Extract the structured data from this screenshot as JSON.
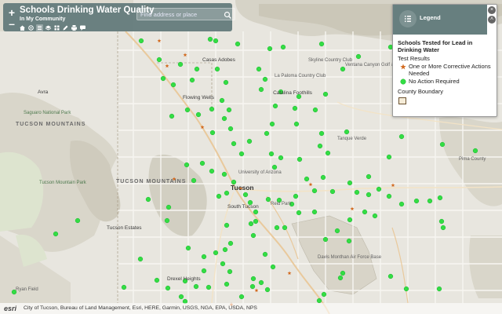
{
  "header": {
    "title": "Schools Drinking Water Quality",
    "subtitle": "In My Community",
    "search_placeholder": "Find address or place",
    "zoom_in": "+",
    "zoom_out": "–"
  },
  "legend": {
    "title": "Legend",
    "layer_title": "Schools Tested for Lead in Drinking Water",
    "test_results_label": "Test Results",
    "items": [
      {
        "label": "One or More Corrective Actions Needed",
        "symbol": "star",
        "color": "#d2691e"
      },
      {
        "label": "No Action Required",
        "symbol": "circle",
        "color": "#33dd44"
      }
    ],
    "boundary_label": "County Boundary"
  },
  "attribution": {
    "logo": "esri",
    "text": "City of Tucson, Bureau of Land Management, Esri, HERE, Garmin, USGS, NGA, EPA, USDA, NPS"
  },
  "colors": {
    "header_bg": "#5f7878",
    "no_action": "#33dd44",
    "corrective": "#d2691e",
    "land": "#e8e6df",
    "terrain": "#d9d7cc"
  },
  "icons": [
    "plus-icon",
    "minus-icon",
    "home-icon",
    "locate-icon",
    "list-icon",
    "layers-icon",
    "grid-icon",
    "pencil-icon",
    "print-icon",
    "chat-icon",
    "search-icon",
    "legend-list-icon",
    "chevron-up-icon",
    "close-icon"
  ],
  "map_labels": {
    "casas_adobes": "Casas Adobes",
    "flowing_wells": "Flowing Wells",
    "catalina_foothills": "Catalina Foothills",
    "tucson_mountains": "TUCSON MOUNTAINS",
    "tucson_mountains_2": "TUCSON MOUNTAINS",
    "tucson": "Tucson",
    "south_tucson": "South Tucson",
    "tucson_estates": "Tucson Estates",
    "drexel_heights": "Drexel Heights",
    "avra": "Avra",
    "saguaro_np": "Saguaro National Park",
    "tucson_mountain_park": "Tucson Mountain Park",
    "dm_afb": "Davis Monthan Air Force Base",
    "u_of_a": "University of Arizona",
    "la_paloma": "La Paloma Country Club",
    "skyline": "Skyline Country Club",
    "ventana": "Ventana Canyon Golf & Racquet Club",
    "tanque_verde": "Tanque Verde",
    "reid_park": "Reid Park",
    "ryan_field": "Ryan Field",
    "pima_county": "Pima County"
  },
  "chart_data": {
    "type": "scatter",
    "title": "Schools Tested for Lead in Drinking Water",
    "series": [
      {
        "name": "One or More Corrective Actions Needed",
        "symbol": "star",
        "points": [
          [
            203,
            52
          ],
          [
            236,
            70
          ],
          [
            213,
            84
          ],
          [
            258,
            162
          ],
          [
            222,
            228
          ],
          [
            369,
            348
          ],
          [
            396,
            235
          ],
          [
            501,
            236
          ],
          [
            449,
            266
          ],
          [
            327,
            370
          ],
          [
            295,
            388
          ],
          [
            187,
            8
          ],
          [
            307,
            240
          ]
        ]
      },
      {
        "name": "No Action Required",
        "symbol": "circle",
        "points": [
          [
            180,
            52
          ],
          [
            275,
            52
          ],
          [
            268,
            50
          ],
          [
            303,
            56
          ],
          [
            344,
            62
          ],
          [
            361,
            60
          ],
          [
            410,
            56
          ],
          [
            437,
            88
          ],
          [
            457,
            72
          ],
          [
            498,
            60
          ],
          [
            203,
            76
          ],
          [
            208,
            100
          ],
          [
            230,
            82
          ],
          [
            251,
            88
          ],
          [
            245,
            102
          ],
          [
            221,
            108
          ],
          [
            277,
            88
          ],
          [
            288,
            105
          ],
          [
            330,
            88
          ],
          [
            338,
            101
          ],
          [
            333,
            114
          ],
          [
            358,
            117
          ],
          [
            381,
            123
          ],
          [
            351,
            135
          ],
          [
            376,
            138
          ],
          [
            402,
            140
          ],
          [
            415,
            120
          ],
          [
            378,
            158
          ],
          [
            347,
            158
          ],
          [
            283,
            128
          ],
          [
            292,
            140
          ],
          [
            270,
            139
          ],
          [
            239,
            140
          ],
          [
            219,
            148
          ],
          [
            253,
            146
          ],
          [
            286,
            151
          ],
          [
            294,
            164
          ],
          [
            271,
            169
          ],
          [
            298,
            183
          ],
          [
            318,
            180
          ],
          [
            308,
            196
          ],
          [
            346,
            196
          ],
          [
            358,
            201
          ],
          [
            350,
            213
          ],
          [
            382,
            203
          ],
          [
            408,
            186
          ],
          [
            410,
            170
          ],
          [
            442,
            168
          ],
          [
            512,
            174
          ],
          [
            564,
            184
          ],
          [
            606,
            192
          ],
          [
            238,
            210
          ],
          [
            258,
            208
          ],
          [
            247,
            230
          ],
          [
            270,
            218
          ],
          [
            286,
            222
          ],
          [
            298,
            232
          ],
          [
            289,
            246
          ],
          [
            279,
            250
          ],
          [
            313,
            248
          ],
          [
            319,
            258
          ],
          [
            326,
            270
          ],
          [
            342,
            254
          ],
          [
            356,
            255
          ],
          [
            372,
            260
          ],
          [
            381,
            271
          ],
          [
            401,
            270
          ],
          [
            391,
            228
          ],
          [
            412,
            226
          ],
          [
            424,
            244
          ],
          [
            446,
            233
          ],
          [
            455,
            245
          ],
          [
            470,
            248
          ],
          [
            483,
            241
          ],
          [
            496,
            250
          ],
          [
            512,
            260
          ],
          [
            531,
            256
          ],
          [
            548,
            256
          ],
          [
            561,
            252
          ],
          [
            465,
            270
          ],
          [
            478,
            275
          ],
          [
            446,
            280
          ],
          [
            430,
            294
          ],
          [
            445,
            307
          ],
          [
            563,
            282
          ],
          [
            565,
            290
          ],
          [
            560,
            368
          ],
          [
            518,
            368
          ],
          [
            498,
            352
          ],
          [
            437,
            348
          ],
          [
            434,
            354
          ],
          [
            413,
            375
          ],
          [
            407,
            383
          ],
          [
            289,
            287
          ],
          [
            294,
            310
          ],
          [
            287,
            318
          ],
          [
            275,
            322
          ],
          [
            260,
            327
          ],
          [
            284,
            336
          ],
          [
            293,
            346
          ],
          [
            289,
            362
          ],
          [
            323,
            355
          ],
          [
            333,
            360
          ],
          [
            322,
            365
          ],
          [
            348,
            340
          ],
          [
            338,
            324
          ],
          [
            323,
            300
          ],
          [
            320,
            285
          ],
          [
            326,
            282
          ],
          [
            179,
            330
          ],
          [
            158,
            366
          ],
          [
            200,
            357
          ],
          [
            214,
            367
          ],
          [
            236,
            358
          ],
          [
            250,
            365
          ],
          [
            231,
            378
          ],
          [
            236,
            384
          ],
          [
            266,
            366
          ],
          [
            260,
            345
          ],
          [
            240,
            316
          ],
          [
            213,
            281
          ],
          [
            215,
            264
          ],
          [
            189,
            254
          ],
          [
            99,
            281
          ],
          [
            71,
            298
          ],
          [
            18,
            372
          ],
          [
            308,
            378
          ],
          [
            341,
            369
          ],
          [
            353,
            290
          ],
          [
            363,
            290
          ],
          [
            401,
            243
          ],
          [
            377,
            250
          ],
          [
            415,
            305
          ],
          [
            470,
            225
          ],
          [
            496,
            200
          ],
          [
            418,
            195
          ],
          [
            340,
            170
          ]
        ]
      }
    ]
  }
}
